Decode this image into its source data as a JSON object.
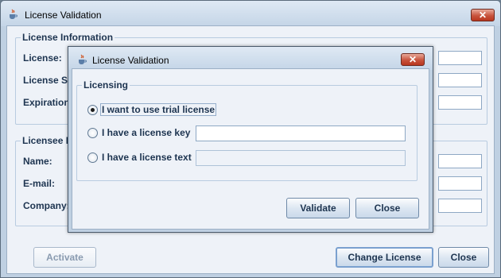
{
  "main_window": {
    "title": "License Validation",
    "close_glyph": "✕",
    "license_info": {
      "title": "License Information",
      "labels": [
        "License:",
        "License St",
        "Expiration"
      ]
    },
    "licensee_info": {
      "title": "Licensee In",
      "labels": [
        "Name:",
        "E-mail:",
        "Company:"
      ]
    },
    "buttons": {
      "activate": "Activate",
      "change_license": "Change License",
      "close": "Close"
    }
  },
  "dialog": {
    "title": "License Validation",
    "close_glyph": "✕",
    "group_title": "Licensing",
    "options": [
      {
        "label": "I want to use trial license",
        "selected": true
      },
      {
        "label": "I have a license key",
        "selected": false,
        "value": ""
      },
      {
        "label": "I have a license text",
        "selected": false,
        "value": ""
      }
    ],
    "buttons": {
      "validate": "Validate",
      "close": "Close"
    }
  },
  "icons": {
    "app": "java-cup-icon",
    "close": "close-icon"
  },
  "colors": {
    "title_gradient_top": "#dfe9f4",
    "client_bg": "#eef2f8",
    "label_text": "#1d3450",
    "close_button_red": "#c8543d"
  }
}
